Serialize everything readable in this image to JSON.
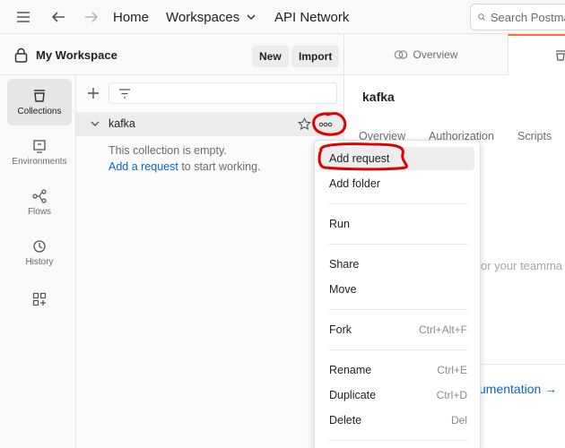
{
  "nav": {
    "home": "Home",
    "workspaces": "Workspaces",
    "api_network": "API Network",
    "search_placeholder": "Search Postman"
  },
  "workspace": {
    "title": "My Workspace",
    "new_label": "New",
    "import_label": "Import"
  },
  "rail": [
    {
      "label": "Collections",
      "icon": "collections-icon"
    },
    {
      "label": "Environments",
      "icon": "environments-icon"
    },
    {
      "label": "Flows",
      "icon": "flows-icon"
    },
    {
      "label": "History",
      "icon": "history-icon"
    }
  ],
  "collection": {
    "name": "kafka",
    "empty_text": "This collection is empty.",
    "add_request_link": "Add a request",
    "empty_suffix": " to start working."
  },
  "right": {
    "overview_tab": "Overview",
    "title": "kafka",
    "tabs": [
      "Overview",
      "Authorization",
      "Scripts"
    ],
    "teammates_text": "or your teamma",
    "documentation_link": "umentation →"
  },
  "menu": {
    "items": [
      {
        "label": "Add request",
        "shortcut": ""
      },
      {
        "label": "Add folder",
        "shortcut": ""
      },
      {
        "label": "Run",
        "shortcut": ""
      },
      {
        "label": "Share",
        "shortcut": ""
      },
      {
        "label": "Move",
        "shortcut": ""
      },
      {
        "label": "Fork",
        "shortcut": "Ctrl+Alt+F"
      },
      {
        "label": "Rename",
        "shortcut": "Ctrl+E"
      },
      {
        "label": "Duplicate",
        "shortcut": "Ctrl+D"
      },
      {
        "label": "Delete",
        "shortcut": "Del"
      }
    ]
  },
  "colors": {
    "accent": "#ff6c37",
    "link": "#0b65c2",
    "annotation": "#e00000"
  }
}
